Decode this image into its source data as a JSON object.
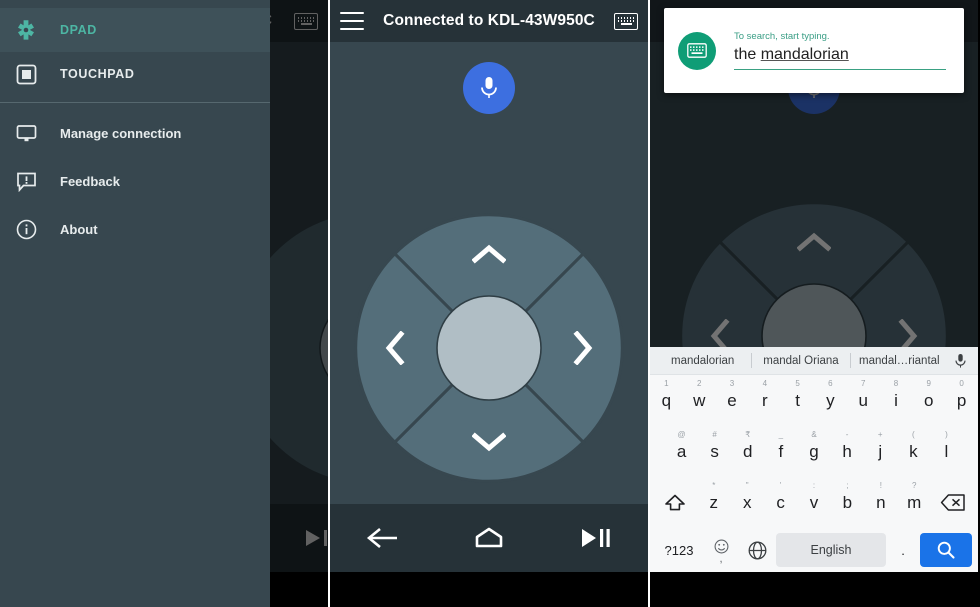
{
  "panel1": {
    "drawer": {
      "items": [
        {
          "label": "DPAD",
          "icon": "dpad-icon",
          "selected": true
        },
        {
          "label": "TOUCHPAD",
          "icon": "touchpad-icon",
          "selected": false
        },
        {
          "label": "Manage connection",
          "icon": "monitor-icon",
          "selected": false
        },
        {
          "label": "Feedback",
          "icon": "feedback-icon",
          "selected": false
        },
        {
          "label": "About",
          "icon": "info-icon",
          "selected": false
        }
      ]
    },
    "background": {
      "title_fragment": "C",
      "keyboard_icon": "keyboard-icon"
    },
    "accent_color": "#4db6a4"
  },
  "panel2": {
    "appbar": {
      "menu_icon": "hamburger-icon",
      "title": "Connected to KDL-43W950C",
      "keyboard_icon": "keyboard-icon"
    },
    "mic_button": {
      "icon": "microphone-icon",
      "color": "#3d6fe0"
    },
    "dpad": {
      "up": "chevron-up-icon",
      "down": "chevron-down-icon",
      "left": "chevron-left-icon",
      "right": "chevron-right-icon",
      "center": "dpad-center-button",
      "ring_color": "#546e7a",
      "center_color": "#b0bec5"
    },
    "navbar": {
      "back": "back-arrow-icon",
      "home": "home-icon",
      "playpause": "play-pause-icon"
    }
  },
  "panel3": {
    "search_card": {
      "icon": "keyboard-icon",
      "icon_color": "#0f9d76",
      "hint": "To search, start typing.",
      "value_prefix": "the ",
      "value_spellchecked": "mandalorian"
    },
    "keyboard": {
      "suggestions": [
        "mandalorian",
        "mandal Oriana",
        "mandal…riantal"
      ],
      "suggestion_mic": "microphone-icon",
      "row1": [
        {
          "key": "q",
          "hint": "1"
        },
        {
          "key": "w",
          "hint": "2"
        },
        {
          "key": "e",
          "hint": "3"
        },
        {
          "key": "r",
          "hint": "4"
        },
        {
          "key": "t",
          "hint": "5"
        },
        {
          "key": "y",
          "hint": "6"
        },
        {
          "key": "u",
          "hint": "7"
        },
        {
          "key": "i",
          "hint": "8"
        },
        {
          "key": "o",
          "hint": "9"
        },
        {
          "key": "p",
          "hint": "0"
        }
      ],
      "row2": [
        {
          "key": "a",
          "hint": "@"
        },
        {
          "key": "s",
          "hint": "#"
        },
        {
          "key": "d",
          "hint": "₹"
        },
        {
          "key": "f",
          "hint": "_"
        },
        {
          "key": "g",
          "hint": "&"
        },
        {
          "key": "h",
          "hint": "-"
        },
        {
          "key": "j",
          "hint": "+"
        },
        {
          "key": "k",
          "hint": "("
        },
        {
          "key": "l",
          "hint": ")"
        }
      ],
      "row3": [
        {
          "key": "z",
          "hint": "*"
        },
        {
          "key": "x",
          "hint": "\""
        },
        {
          "key": "c",
          "hint": "'"
        },
        {
          "key": "v",
          "hint": ":"
        },
        {
          "key": "b",
          "hint": ";"
        },
        {
          "key": "n",
          "hint": "!"
        },
        {
          "key": "m",
          "hint": "?"
        }
      ],
      "shift_icon": "shift-icon",
      "backspace_icon": "backspace-icon",
      "bottom": {
        "symbols": "?123",
        "emoji_icon": "emoji-icon",
        "comma": ",",
        "globe_icon": "globe-icon",
        "space_label": "English",
        "period": ".",
        "search_icon": "search-icon",
        "search_color": "#1a73e8"
      }
    }
  }
}
